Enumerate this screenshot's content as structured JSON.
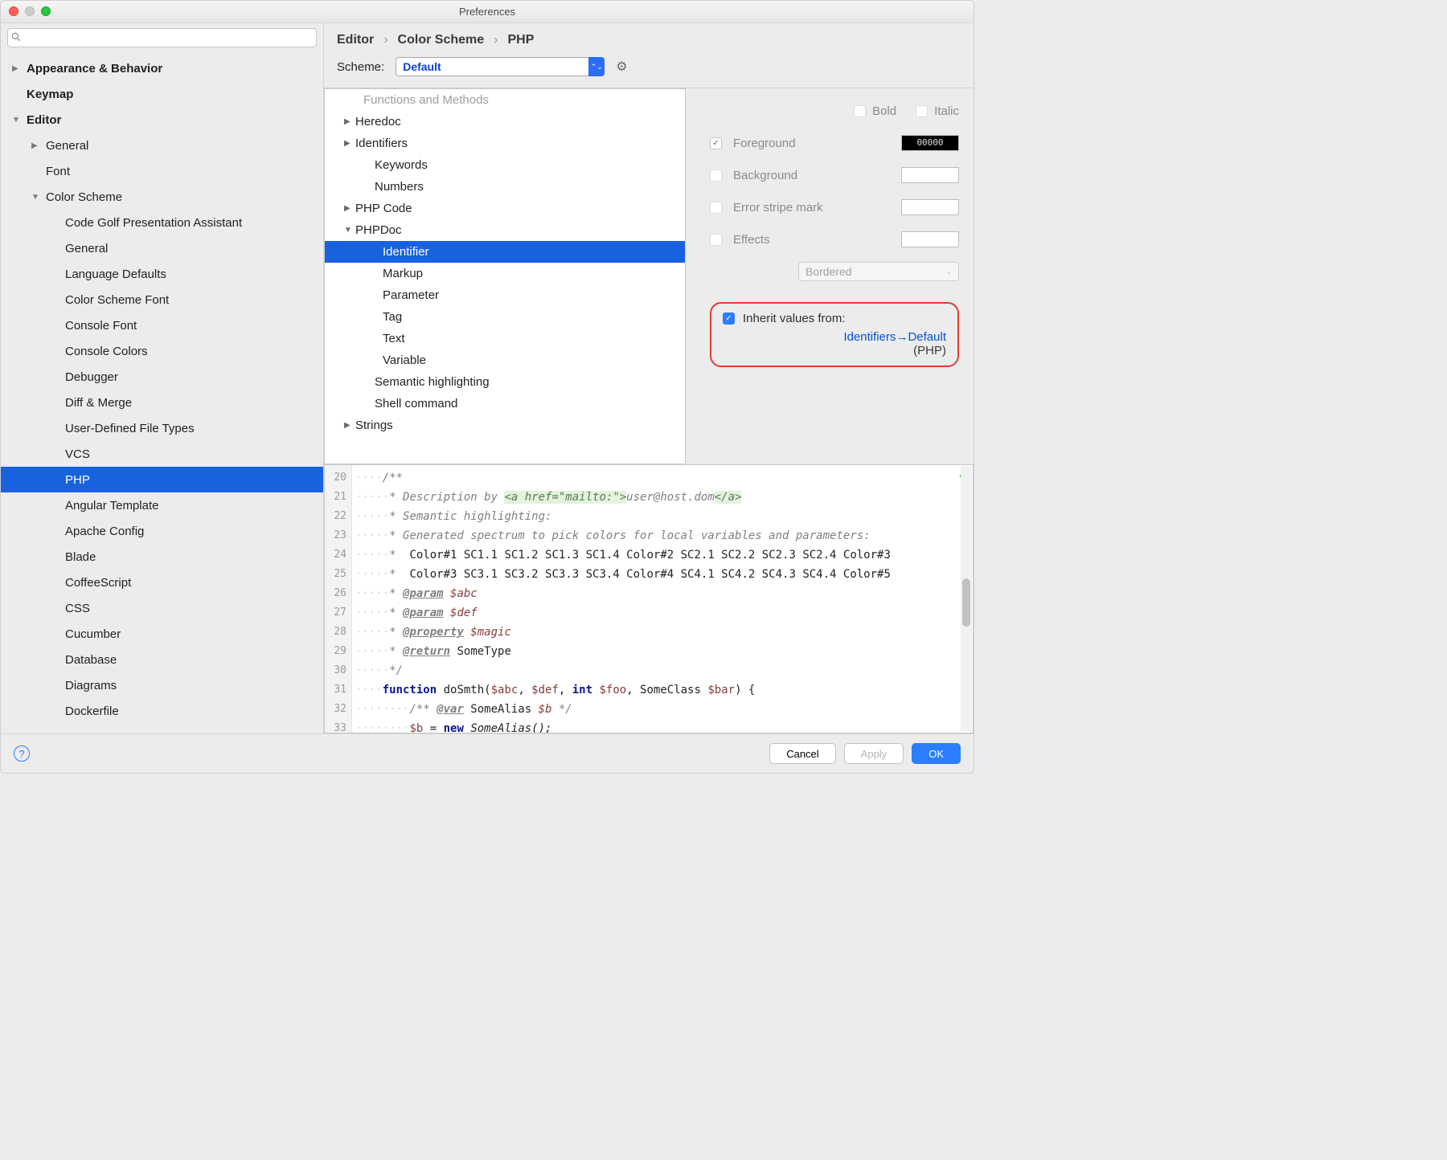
{
  "window": {
    "title": "Preferences"
  },
  "search": {
    "placeholder": ""
  },
  "sidebar": [
    {
      "label": "Appearance & Behavior",
      "depth": 0,
      "bold": true,
      "arrow": "right"
    },
    {
      "label": "Keymap",
      "depth": 0,
      "bold": true
    },
    {
      "label": "Editor",
      "depth": 0,
      "bold": true,
      "arrow": "down"
    },
    {
      "label": "General",
      "depth": 1,
      "arrow": "right"
    },
    {
      "label": "Font",
      "depth": 1
    },
    {
      "label": "Color Scheme",
      "depth": 1,
      "arrow": "down"
    },
    {
      "label": "Code Golf Presentation Assistant",
      "depth": 2
    },
    {
      "label": "General",
      "depth": 2
    },
    {
      "label": "Language Defaults",
      "depth": 2
    },
    {
      "label": "Color Scheme Font",
      "depth": 2
    },
    {
      "label": "Console Font",
      "depth": 2
    },
    {
      "label": "Console Colors",
      "depth": 2
    },
    {
      "label": "Debugger",
      "depth": 2
    },
    {
      "label": "Diff & Merge",
      "depth": 2
    },
    {
      "label": "User-Defined File Types",
      "depth": 2
    },
    {
      "label": "VCS",
      "depth": 2
    },
    {
      "label": "PHP",
      "depth": 2,
      "selected": true
    },
    {
      "label": "Angular Template",
      "depth": 2
    },
    {
      "label": "Apache Config",
      "depth": 2
    },
    {
      "label": "Blade",
      "depth": 2
    },
    {
      "label": "CoffeeScript",
      "depth": 2
    },
    {
      "label": "CSS",
      "depth": 2
    },
    {
      "label": "Cucumber",
      "depth": 2
    },
    {
      "label": "Database",
      "depth": 2
    },
    {
      "label": "Diagrams",
      "depth": 2
    },
    {
      "label": "Dockerfile",
      "depth": 2
    }
  ],
  "breadcrumb": {
    "a": "Editor",
    "b": "Color Scheme",
    "c": "PHP"
  },
  "scheme": {
    "label": "Scheme:",
    "value": "Default"
  },
  "categories": [
    {
      "label": "Functions and Methods",
      "arrow": "",
      "indent": 1,
      "cut": true
    },
    {
      "label": "Heredoc",
      "arrow": "right",
      "indent": 0
    },
    {
      "label": "Identifiers",
      "arrow": "right",
      "indent": 0
    },
    {
      "label": "Keywords",
      "arrow": "",
      "indent": 1,
      "spacer": true
    },
    {
      "label": "Numbers",
      "arrow": "",
      "indent": 1,
      "spacer": true
    },
    {
      "label": "PHP Code",
      "arrow": "right",
      "indent": 0
    },
    {
      "label": "PHPDoc",
      "arrow": "down",
      "indent": 0
    },
    {
      "label": "Identifier",
      "arrow": "",
      "indent": 2,
      "selected": true
    },
    {
      "label": "Markup",
      "arrow": "",
      "indent": 2
    },
    {
      "label": "Parameter",
      "arrow": "",
      "indent": 2
    },
    {
      "label": "Tag",
      "arrow": "",
      "indent": 2
    },
    {
      "label": "Text",
      "arrow": "",
      "indent": 2
    },
    {
      "label": "Variable",
      "arrow": "",
      "indent": 2
    },
    {
      "label": "Semantic highlighting",
      "arrow": "",
      "indent": 1,
      "spacer": true
    },
    {
      "label": "Shell command",
      "arrow": "",
      "indent": 1,
      "spacer": true
    },
    {
      "label": "Strings",
      "arrow": "right",
      "indent": 0
    }
  ],
  "props": {
    "bold": "Bold",
    "italic": "Italic",
    "foreground": "Foreground",
    "foreground_val": "00000",
    "background": "Background",
    "error_stripe": "Error stripe mark",
    "effects": "Effects",
    "effects_type": "Bordered"
  },
  "inherit": {
    "label": "Inherit values from:",
    "link": "Identifiers→Default",
    "paren": "(PHP)"
  },
  "gutter_lines": "20\n21\n22\n23\n24\n25\n26\n27\n28\n29\n30\n31\n32\n33",
  "code": {
    "l20": {
      "ws": "····",
      "pre": "/**"
    },
    "l21": {
      "ws": "·····",
      "star": "* ",
      "txt": "Description by ",
      "tag": "<a href=\"mailto:\">",
      "mid": "user@host.dom",
      "end": "</a>"
    },
    "l22": {
      "ws": "·····",
      "star": "* ",
      "txt": "Semantic highlighting:"
    },
    "l23": {
      "ws": "·····",
      "star": "* ",
      "txt": "Generated spectrum to pick colors for local variables and parameters:"
    },
    "l24": {
      "ws": "·····",
      "star": "*  ",
      "rest": "Color#1 SC1.1 SC1.2 SC1.3 SC1.4 Color#2 SC2.1 SC2.2 SC2.3 SC2.4 Color#3"
    },
    "l25": {
      "ws": "·····",
      "star": "*  ",
      "rest": "Color#3 SC3.1 SC3.2 SC3.3 SC3.4 Color#4 SC4.1 SC4.2 SC4.3 SC4.4 Color#5"
    },
    "l26": {
      "ws": "·····",
      "star": "* ",
      "tag": "@param",
      "var": " $abc"
    },
    "l27": {
      "ws": "·····",
      "star": "* ",
      "tag": "@param",
      "var": " $def"
    },
    "l28": {
      "ws": "·····",
      "star": "* ",
      "tag": "@property",
      "var": " $magic"
    },
    "l29": {
      "ws": "·····",
      "star": "* ",
      "tag": "@return",
      "rest": " SomeType"
    },
    "l30": {
      "ws": "·····",
      "star": "*/"
    },
    "l31": {
      "ws": "····",
      "kw": "function",
      "fn": " doSmth(",
      "v1": "$abc",
      "c1": ", ",
      "v2": "$def",
      "c2": ", ",
      "kw2": "int",
      "sp": " ",
      "v3": "$foo",
      "c3": ", SomeClass ",
      "v4": "$bar",
      "end": ") {"
    },
    "l32": {
      "ws": "········",
      "open": "/** ",
      "tag": "@var",
      "rest": " SomeAlias ",
      "var": "$b",
      "close": " */"
    },
    "l33": {
      "ws": "········",
      "v": "$b",
      "eq": " = ",
      "kw": "new",
      "rest": " SomeAlias();"
    }
  },
  "footer": {
    "cancel": "Cancel",
    "apply": "Apply",
    "ok": "OK"
  }
}
